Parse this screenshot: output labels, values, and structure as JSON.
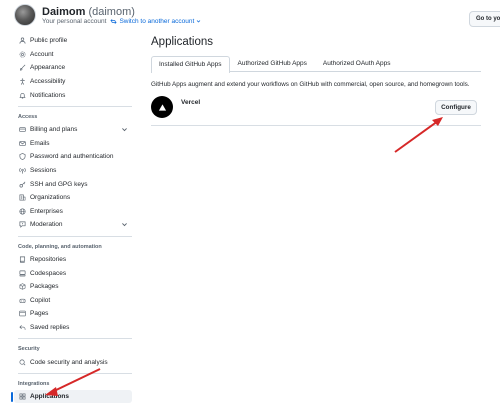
{
  "header": {
    "display_name": "Daimom",
    "handle": "(daimom)",
    "account_type": "Your personal account",
    "switch_label": "Switch to another account",
    "go_to_profile": "Go to your"
  },
  "sidebar": {
    "top_items": [
      {
        "label": "Public profile",
        "icon": "person-icon"
      },
      {
        "label": "Account",
        "icon": "gear-icon"
      },
      {
        "label": "Appearance",
        "icon": "paintbrush-icon"
      },
      {
        "label": "Accessibility",
        "icon": "accessibility-icon"
      },
      {
        "label": "Notifications",
        "icon": "bell-icon"
      }
    ],
    "access_heading": "Access",
    "access_items": [
      {
        "label": "Billing and plans",
        "icon": "credit-card-icon"
      },
      {
        "label": "Emails",
        "icon": "mail-icon"
      },
      {
        "label": "Password and authentication",
        "icon": "shield-lock-icon"
      },
      {
        "label": "Sessions",
        "icon": "broadcast-icon"
      },
      {
        "label": "SSH and GPG keys",
        "icon": "key-icon"
      },
      {
        "label": "Organizations",
        "icon": "organization-icon"
      },
      {
        "label": "Enterprises",
        "icon": "globe-icon"
      },
      {
        "label": "Moderation",
        "icon": "report-icon"
      }
    ],
    "code_heading": "Code, planning, and automation",
    "code_items": [
      {
        "label": "Repositories",
        "icon": "repo-icon"
      },
      {
        "label": "Codespaces",
        "icon": "codespaces-icon"
      },
      {
        "label": "Packages",
        "icon": "package-icon"
      },
      {
        "label": "Copilot",
        "icon": "copilot-icon"
      },
      {
        "label": "Pages",
        "icon": "browser-icon"
      },
      {
        "label": "Saved replies",
        "icon": "reply-icon"
      }
    ],
    "security_heading": "Security",
    "security_items": [
      {
        "label": "Code security and analysis",
        "icon": "codescan-icon"
      }
    ],
    "integrations_heading": "Integrations",
    "integrations_items": [
      {
        "label": "Applications",
        "icon": "apps-icon"
      }
    ]
  },
  "main": {
    "title": "Applications",
    "tabs": [
      {
        "label": "Installed GitHub Apps"
      },
      {
        "label": "Authorized GitHub Apps"
      },
      {
        "label": "Authorized OAuth Apps"
      }
    ],
    "intro": "GitHub Apps augment and extend your workflows on GitHub with commercial, open source, and homegrown tools.",
    "apps": [
      {
        "name": "Vercel",
        "action": "Configure"
      }
    ]
  },
  "colors": {
    "accent": "#0969da",
    "annotation_arrow": "#d62828",
    "border": "#d0d7de"
  }
}
